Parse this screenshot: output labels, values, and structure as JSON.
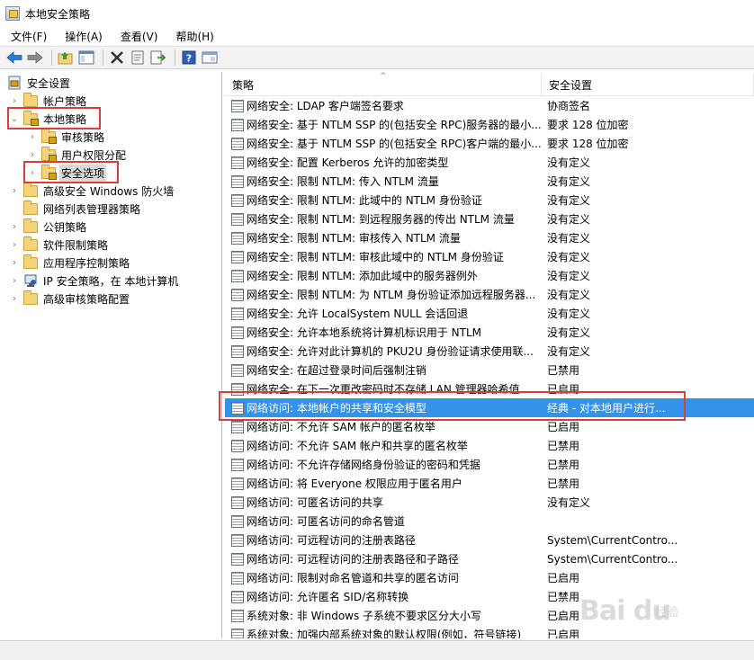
{
  "window": {
    "title": "本地安全策略"
  },
  "menu": [
    "文件(F)",
    "操作(A)",
    "查看(V)",
    "帮助(H)"
  ],
  "toolbar": {
    "icons": [
      "back-arrow-icon",
      "forward-arrow-icon",
      "up-folder-icon",
      "show-tree-icon",
      "delete-icon",
      "properties-icon",
      "export-icon",
      "help-icon",
      "console-icon"
    ]
  },
  "tree": {
    "root": "安全设置",
    "items": [
      {
        "label": "帐户策略",
        "expanded": false
      },
      {
        "label": "本地策略",
        "expanded": true
      },
      {
        "label": "审核策略",
        "child": true
      },
      {
        "label": "用户权限分配",
        "child": true
      },
      {
        "label": "安全选项",
        "child": true,
        "selected": true
      },
      {
        "label": "高级安全 Windows 防火墙"
      },
      {
        "label": "网络列表管理器策略"
      },
      {
        "label": "公钥策略"
      },
      {
        "label": "软件限制策略"
      },
      {
        "label": "应用程序控制策略"
      },
      {
        "label": "IP 安全策略，在 本地计算机"
      },
      {
        "label": "高级审核策略配置"
      }
    ]
  },
  "columns": {
    "policy": "策略",
    "setting": "安全设置"
  },
  "policies": [
    {
      "name": "网络安全: LDAP 客户端签名要求",
      "setting": "协商签名"
    },
    {
      "name": "网络安全: 基于 NTLM SSP 的(包括安全 RPC)服务器的最小...",
      "setting": "要求 128 位加密"
    },
    {
      "name": "网络安全: 基于 NTLM SSP 的(包括安全 RPC)客户端的最小...",
      "setting": "要求 128 位加密"
    },
    {
      "name": "网络安全: 配置 Kerberos 允许的加密类型",
      "setting": "没有定义"
    },
    {
      "name": "网络安全: 限制 NTLM: 传入 NTLM 流量",
      "setting": "没有定义"
    },
    {
      "name": "网络安全: 限制 NTLM: 此域中的 NTLM 身份验证",
      "setting": "没有定义"
    },
    {
      "name": "网络安全: 限制 NTLM: 到远程服务器的传出 NTLM 流量",
      "setting": "没有定义"
    },
    {
      "name": "网络安全: 限制 NTLM: 审核传入 NTLM 流量",
      "setting": "没有定义"
    },
    {
      "name": "网络安全: 限制 NTLM: 审核此域中的 NTLM 身份验证",
      "setting": "没有定义"
    },
    {
      "name": "网络安全: 限制 NTLM: 添加此域中的服务器例外",
      "setting": "没有定义"
    },
    {
      "name": "网络安全: 限制 NTLM: 为 NTLM 身份验证添加远程服务器...",
      "setting": "没有定义"
    },
    {
      "name": "网络安全: 允许 LocalSystem NULL 会话回退",
      "setting": "没有定义"
    },
    {
      "name": "网络安全: 允许本地系统将计算机标识用于 NTLM",
      "setting": "没有定义"
    },
    {
      "name": "网络安全: 允许对此计算机的 PKU2U 身份验证请求使用联...",
      "setting": "没有定义"
    },
    {
      "name": "网络安全: 在超过登录时间后强制注销",
      "setting": "已禁用"
    },
    {
      "name": "网络安全: 在下一次更改密码时不存储 LAN 管理器哈希值",
      "setting": "已启用"
    },
    {
      "name": "网络访问: 本地帐户的共享和安全模型",
      "setting": "经典 - 对本地用户进行...",
      "selected": true
    },
    {
      "name": "网络访问: 不允许 SAM 帐户的匿名枚举",
      "setting": "已启用"
    },
    {
      "name": "网络访问: 不允许 SAM 帐户和共享的匿名枚举",
      "setting": "已禁用"
    },
    {
      "name": "网络访问: 不允许存储网络身份验证的密码和凭据",
      "setting": "已禁用"
    },
    {
      "name": "网络访问: 将 Everyone 权限应用于匿名用户",
      "setting": "已禁用"
    },
    {
      "name": "网络访问: 可匿名访问的共享",
      "setting": "没有定义"
    },
    {
      "name": "网络访问: 可匿名访问的命名管道",
      "setting": ""
    },
    {
      "name": "网络访问: 可远程访问的注册表路径",
      "setting": "System\\CurrentContro..."
    },
    {
      "name": "网络访问: 可远程访问的注册表路径和子路径",
      "setting": "System\\CurrentContro..."
    },
    {
      "name": "网络访问: 限制对命名管道和共享的匿名访问",
      "setting": "已启用"
    },
    {
      "name": "网络访问: 允许匿名 SID/名称转换",
      "setting": "已禁用"
    },
    {
      "name": "系统对象: 非 Windows 子系统不要求区分大小写",
      "setting": "已启用"
    },
    {
      "name": "系统对象: 加强内部系统对象的默认权限(例如，符号链接)",
      "setting": "已启用"
    }
  ],
  "watermark": {
    "text": "Bai du",
    "sub": "经验"
  },
  "colors": {
    "selection": "#3393e8",
    "highlight_box": "#e03a3a"
  }
}
